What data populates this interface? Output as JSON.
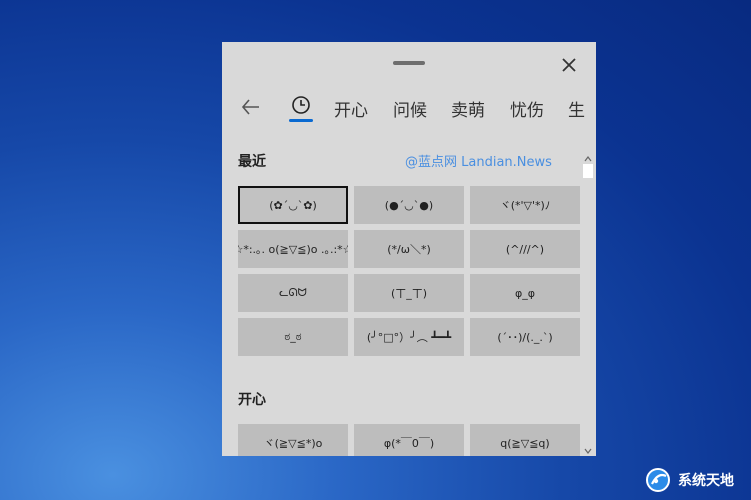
{
  "nav": {
    "tabs": [
      "开心",
      "问候",
      "卖萌",
      "忧伤",
      "生"
    ]
  },
  "sections": {
    "recent_title": "最近",
    "happy_title": "开心"
  },
  "watermark": "@蓝点网 Landian.News",
  "recent": [
    "(✿´◡`✿)",
    "(●´◡`●)",
    "ヾ(*'▽'*)ﾉ",
    "☆*:.｡. o(≧▽≦)o .｡.:*☆",
    "(*/ω＼*)",
    "(^///^)",
    "ᓚᘏᗢ",
    "(ㄒ_ㄒ)",
    "φ_φ",
    "ಠ_ಠ",
    "(╯°□°）╯︵ ┻━┻",
    "(´･･)/(._.`)"
  ],
  "happy": [
    "ヾ(≧▽≦*)o",
    "φ(*￣0￣)",
    "q(≧▽≦q)"
  ],
  "logo": {
    "text": "系统天地"
  },
  "colors": {
    "accent": "#0a6ad1",
    "panel_bg": "#d9d9d9",
    "cell_bg": "#bdbdbd"
  }
}
